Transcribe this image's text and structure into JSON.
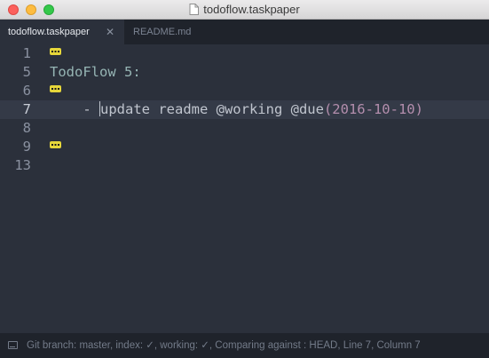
{
  "window": {
    "title": "todoflow.taskpaper"
  },
  "tabs": [
    {
      "label": "todoflow.taskpaper",
      "active": true
    },
    {
      "label": "README.md",
      "active": false
    }
  ],
  "editor": {
    "lines": [
      {
        "number": "1",
        "fold": true,
        "text": ""
      },
      {
        "number": "5",
        "fold": false,
        "text": "TodoFlow 5:"
      },
      {
        "number": "6",
        "fold": true,
        "text": ""
      },
      {
        "number": "7",
        "fold": false,
        "current": true,
        "prefix": "    - ",
        "task": "update readme @working ",
        "tag": "@due",
        "date": "(2016-10-10)"
      },
      {
        "number": "8",
        "fold": false,
        "text": ""
      },
      {
        "number": "9",
        "fold": true,
        "text": ""
      },
      {
        "number": "13",
        "fold": false,
        "text": ""
      }
    ]
  },
  "statusbar": {
    "text": "Git branch: master, index: ✓, working: ✓, Comparing against : HEAD, Line 7, Column 7"
  },
  "colors": {
    "background": "#2b303b",
    "project": "#96b5b4",
    "date": "#b48ead",
    "fold_marker": "#e6d63a"
  },
  "icons": {
    "document": "document-icon",
    "status": "console-icon"
  }
}
